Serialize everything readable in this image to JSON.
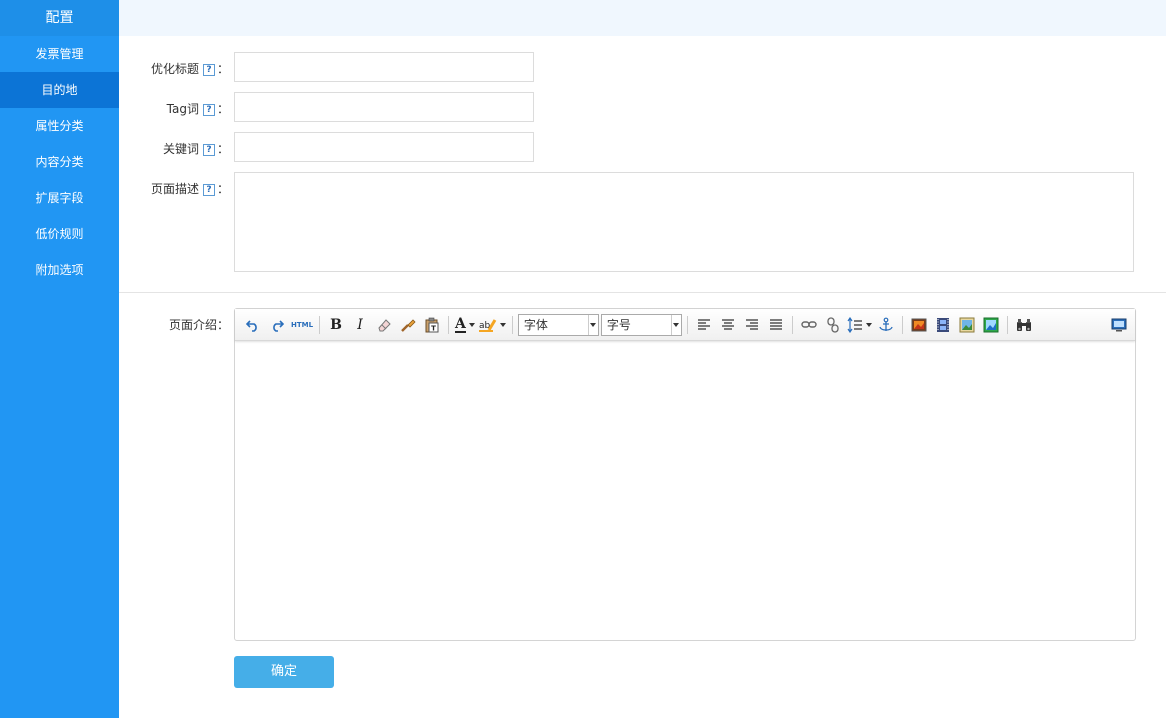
{
  "sidebar": {
    "title": "配置",
    "items": [
      {
        "label": "发票管理"
      },
      {
        "label": "目的地"
      },
      {
        "label": "属性分类"
      },
      {
        "label": "内容分类"
      },
      {
        "label": "扩展字段"
      },
      {
        "label": "低价规则"
      },
      {
        "label": "附加选项"
      }
    ],
    "active_index": 1
  },
  "form": {
    "help_glyph": "?",
    "colon": "：",
    "seo_title": {
      "label": "优化标题",
      "value": ""
    },
    "tag": {
      "label": "Tag词",
      "value": ""
    },
    "keywords": {
      "label": "关键词",
      "value": ""
    },
    "description": {
      "label": "页面描述",
      "value": ""
    },
    "intro": {
      "label": "页面介绍："
    }
  },
  "editor": {
    "html_label": "HTML",
    "font_family_select": "字体",
    "font_size_select": "字号",
    "bold_label": "B",
    "italic_label": "I",
    "forecolor_label": "A",
    "content": ""
  },
  "submit_label": "确定",
  "colors": {
    "sidebar_bg": "#2196F3",
    "sidebar_active": "#0c74d6",
    "topbar_bg": "#f0f7fe",
    "submit_bg": "#45aee8"
  }
}
